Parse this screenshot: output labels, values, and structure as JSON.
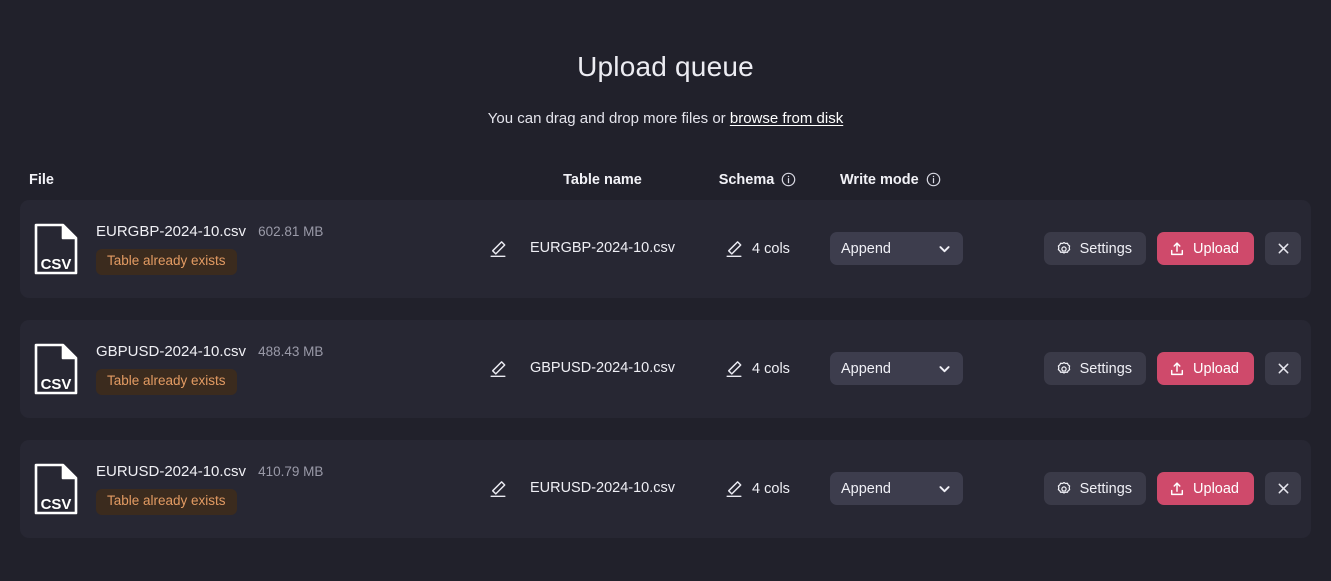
{
  "header": {
    "title": "Upload queue",
    "subtitle_prefix": "You can drag and drop more files or ",
    "browse_link": "browse from disk"
  },
  "columns": {
    "file": "File",
    "table_name": "Table name",
    "schema": "Schema",
    "write_mode": "Write mode",
    "schema_info_icon": "info-icon",
    "write_mode_info_icon": "info-icon"
  },
  "colors": {
    "page_background": "#21212b",
    "row_background": "#272733",
    "upload_button": "#cf4a6b",
    "settings_button": "#3a3a48",
    "select_background": "#3d3d4d",
    "badge_background": "#3b2b1e",
    "badge_text": "#e39b63"
  },
  "actions": {
    "settings_label": "Settings",
    "upload_label": "Upload",
    "close_label": "×",
    "settings_icon": "gear-icon",
    "upload_icon": "upload-tray-icon",
    "close_icon": "close-icon",
    "edit_icon": "pencil-icon",
    "file_icon": "csv-file-icon",
    "chevron_icon": "chevron-down-icon"
  },
  "rows": [
    {
      "file_name": "EURGBP-2024-10.csv",
      "file_size": "602.81 MB",
      "status_badge": "Table already exists",
      "table_name": "EURGBP-2024-10.csv",
      "schema": "4 cols",
      "write_mode": "Append"
    },
    {
      "file_name": "GBPUSD-2024-10.csv",
      "file_size": "488.43 MB",
      "status_badge": "Table already exists",
      "table_name": "GBPUSD-2024-10.csv",
      "schema": "4 cols",
      "write_mode": "Append"
    },
    {
      "file_name": "EURUSD-2024-10.csv",
      "file_size": "410.79 MB",
      "status_badge": "Table already exists",
      "table_name": "EURUSD-2024-10.csv",
      "schema": "4 cols",
      "write_mode": "Append"
    }
  ]
}
